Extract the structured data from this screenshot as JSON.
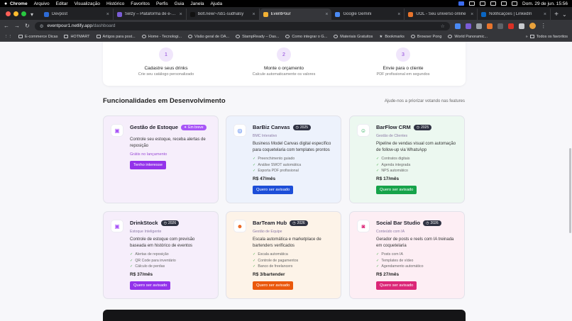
{
  "menubar": {
    "app": "Chrome",
    "items": [
      "Arquivo",
      "Editar",
      "Visualização",
      "Histórico",
      "Favoritos",
      "Perfis",
      "Guia",
      "Janela",
      "Ajuda"
    ],
    "clock": "Dom. 29 de jun.  15:56"
  },
  "tabs": [
    {
      "label": "Devpost",
      "color": "#2d6bd6"
    },
    {
      "label": "Selzy – Plataforma de e-mail",
      "color": "#7b5cd6"
    },
    {
      "label": "bolt.new/~/sb1-sudhalsy",
      "color": "#111111"
    },
    {
      "label": "EventPour",
      "color": "#f2b134",
      "active": true
    },
    {
      "label": "Google Gemini",
      "color": "#4a8af4"
    },
    {
      "label": "UOL - Seu universo online",
      "color": "#e8742c"
    },
    {
      "label": "Notificações | LinkedIn",
      "color": "#0a66c2"
    }
  ],
  "omnibox": {
    "host": "eventpour1.netlify.app",
    "path": "/dashboard"
  },
  "bookmarks": [
    "E-commerce Dicas",
    "HOTMART",
    "Artigos para post...",
    "Home - Tecnologi...",
    "Visão geral de OA...",
    "StampReady – Das...",
    "Como integrar o G...",
    "Materiais Gratuitos",
    "Bookmarks",
    "Browser Pong",
    "World Panoramic..."
  ],
  "bookmarks_all": "Todos os favoritos",
  "steps": [
    {
      "num": "1",
      "title": "Cadastre seus drinks",
      "sub": "Crie seu catálogo personalizado"
    },
    {
      "num": "2",
      "title": "Monte o orçamento",
      "sub": "Calcule automaticamente os valores"
    },
    {
      "num": "3",
      "title": "Envie para o cliente",
      "sub": "PDF profissional em segundos"
    }
  ],
  "section": {
    "title": "Funcionalidades em Desenvolvimento",
    "link": "Ajude-nos a priorizar votando nas features"
  },
  "cards": [
    {
      "name": "Gestão de Estoque",
      "badge": "Em breve",
      "desc": "Controle seu estoque, receba alertas de reposição",
      "launch": "Grátis no lançamento",
      "button": "Tenho interesse",
      "btn_color": "#9333ea",
      "bg": "#f6eefb",
      "icon": "box-icon",
      "icon_color": "#a855f7",
      "glyph": "▣"
    },
    {
      "name": "BarBiz Canvas",
      "badge": "2025",
      "sub": "BMC Interativo",
      "desc": "Business Model Canvas digital específico para coquetelaria com templates prontos",
      "features": [
        "Preenchimento guiado",
        "Análise SWOT automática",
        "Exporta PDF profissional"
      ],
      "price": "R$ 47/mês",
      "button": "Quero ser avisado",
      "btn_color": "#1d4ed8",
      "bg": "#edf2fc",
      "icon": "target-icon",
      "icon_color": "#2563eb",
      "glyph": "◎"
    },
    {
      "name": "BarFlow CRM",
      "badge": "2025",
      "sub": "Gestão de Clientes",
      "desc": "Pipeline de vendas visual com automação de follow-up via WhatsApp",
      "features": [
        "Contratos digitais",
        "Agenda integrada",
        "NPS automático"
      ],
      "price": "R$ 17/mês",
      "button": "Quero ser avisado",
      "btn_color": "#16a34a",
      "bg": "#ecf8f0",
      "icon": "users-icon",
      "icon_color": "#16a34a",
      "glyph": "☺"
    },
    {
      "name": "DrinkStock",
      "badge": "2026",
      "sub": "Estoque Inteligente",
      "desc": "Controle de estoque com previsão baseada em histórico de eventos",
      "features": [
        "Alertas de reposição",
        "QR Code para inventário",
        "Cálculo de perdas"
      ],
      "price": "R$ 37/mês",
      "button": "Quero ser avisado",
      "btn_color": "#9333ea",
      "bg": "#f6eefb",
      "icon": "box-icon",
      "icon_color": "#a855f7",
      "glyph": "▣"
    },
    {
      "name": "BarTeam Hub",
      "badge": "2026",
      "sub": "Gestão de Equipe",
      "desc": "Escala automática e marketplace de bartenders verificados",
      "features": [
        "Escala automática",
        "Controle de pagamentos",
        "Banco de freelancers"
      ],
      "price": "R$ 3/bartender",
      "button": "Quero ser avisado",
      "btn_color": "#ea580c",
      "bg": "#fdf3e8",
      "icon": "user-plus-icon",
      "icon_color": "#ea580c",
      "glyph": "☻"
    },
    {
      "name": "Social Bar Studio",
      "badge": "2026",
      "sub": "Conteúdo com IA",
      "desc": "Gerador de posts e reels com IA treinada em coquetelaria",
      "features": [
        "Posts com IA",
        "Templates de vídeo",
        "Agendamento automático"
      ],
      "price": "R$ 27/mês",
      "button": "Quero ser avisado",
      "btn_color": "#db2777",
      "bg": "#fdeef4",
      "icon": "camera-icon",
      "icon_color": "#db2777",
      "glyph": "◙"
    }
  ]
}
